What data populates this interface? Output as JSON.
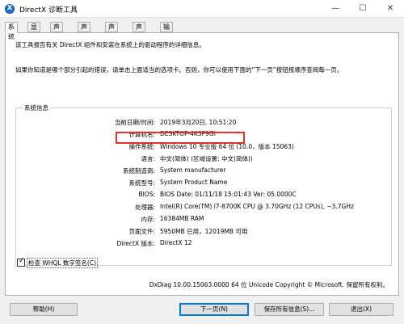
{
  "window": {
    "title": "DirectX 诊断工具",
    "minimize": "—",
    "maximize": "☐",
    "close": "✕"
  },
  "tabs": [
    "系统",
    "显示",
    "声音 1",
    "声音 2",
    "声音 3",
    "声音 4",
    "输入"
  ],
  "intro": {
    "line1": "该工具报告有关 DirectX 组件和安装在系统上的驱动程序的详细信息。",
    "line2": "如果你知道是哪个部分引起的错误，请单击上面适当的选项卡。否则，你可以使用下面的“下一页”按钮按顺序查阅每一页。"
  },
  "system_info": {
    "group_title": "系统信息",
    "rows": [
      {
        "label": "当前日期/时间:",
        "value": "2019年3月20日, 10:51:20"
      },
      {
        "label": "计算机名:",
        "value": "DESKTOP-4K3P9GI"
      },
      {
        "label": "操作系统:",
        "value": "Windows 10 专业版 64 位 (10.0，版本 15063)"
      },
      {
        "label": "语言:",
        "value": "中文(简体) (区域设置: 中文(简体))"
      },
      {
        "label": "系统制造商:",
        "value": "System manufacturer"
      },
      {
        "label": "系统型号:",
        "value": "System Product Name"
      },
      {
        "label": "BIOS:",
        "value": "BIOS Date: 01/11/18 15:01:43 Ver: 05.0000C"
      },
      {
        "label": "处理器:",
        "value": "Intel(R) Core(TM) i7-8700K CPU @ 3.70GHz (12 CPUs), ~3.7GHz"
      },
      {
        "label": "内存:",
        "value": "16384MB RAM"
      },
      {
        "label": "页面文件:",
        "value": "5950MB 已用，12019MB 可用"
      },
      {
        "label": "DirectX 版本:",
        "value": "DirectX 12"
      }
    ]
  },
  "whql_checkbox": {
    "label": "检查 WHQL 数字签名(C)",
    "checked": true
  },
  "footer_info": "DxDiag 10.00.15063.0000 64 位 Unicode  Copyright © Microsoft. 保留所有权利。",
  "buttons": {
    "help": "帮助(H)",
    "next": "下一页(N)",
    "save": "保存所有信息(S)...",
    "exit": "退出(X)"
  },
  "colors": {
    "highlight_border": "#e03030",
    "default_button_border": "#0078d7"
  }
}
